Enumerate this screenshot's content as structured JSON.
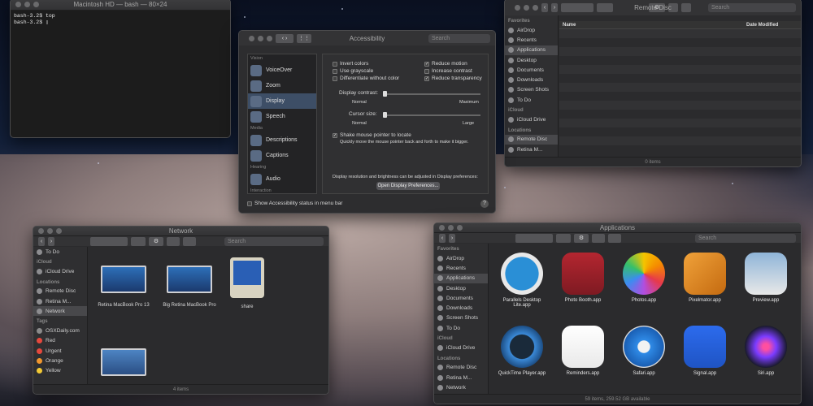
{
  "terminal": {
    "title": "Macintosh HD — bash — 80×24",
    "lines": [
      "bash-3.2$ top",
      "bash-3.2$ ▯"
    ]
  },
  "accessibility": {
    "title": "Accessibility",
    "search_placeholder": "Search",
    "categories": {
      "vision": "Vision",
      "media": "Media",
      "hearing": "Hearing",
      "interaction": "Interaction"
    },
    "items": [
      "VoiceOver",
      "Zoom",
      "Display",
      "Speech",
      "Descriptions",
      "Captions",
      "Audio"
    ],
    "options_left": [
      "Invert colors",
      "Use grayscale",
      "Differentiate without color"
    ],
    "options_right": [
      "Reduce motion",
      "Increase contrast",
      "Reduce transparency"
    ],
    "contrast_label": "Display contrast:",
    "contrast_min": "Normal",
    "contrast_max": "Maximum",
    "cursor_label": "Cursor size:",
    "cursor_min": "Normal",
    "cursor_max": "Large",
    "shake_label": "Shake mouse pointer to locate",
    "shake_desc": "Quickly move the mouse pointer back and forth to make it bigger.",
    "note": "Display resolution and brightness can be adjusted in Display preferences:",
    "open_button": "Open Display Preferences...",
    "status_label": "Show Accessibility status in menu bar",
    "help": "?"
  },
  "remote": {
    "title": "Remote Disc",
    "search_placeholder": "Search",
    "status": "0 items",
    "favorites_title": "Favorites",
    "favorites": [
      "AirDrop",
      "Recents",
      "Applications",
      "Desktop",
      "Documents",
      "Downloads",
      "Screen Shots",
      "To Do"
    ],
    "icloud_title": "iCloud",
    "icloud": [
      "iCloud Drive"
    ],
    "locations_title": "Locations",
    "locations": [
      "Remote Disc",
      "Retina M..."
    ],
    "col_name": "Name",
    "col_date": "Date Modified"
  },
  "network": {
    "title": "Network",
    "search_placeholder": "Search",
    "status": "4 items",
    "sidebar_top": "To Do",
    "icloud_title": "iCloud",
    "icloud": "iCloud Drive",
    "locations_title": "Locations",
    "locations": [
      "Remote Disc",
      "Retina M...",
      "Network"
    ],
    "tags_title": "Tags",
    "tags": [
      {
        "name": "OSXDaily.com",
        "color": "#8a8a8a"
      },
      {
        "name": "Red",
        "color": "#e5483d"
      },
      {
        "name": "Urgent",
        "color": "#e5483d"
      },
      {
        "name": "Orange",
        "color": "#f0962e"
      },
      {
        "name": "Yellow",
        "color": "#f3c935"
      }
    ],
    "items": [
      "Retina MacBook Pro 13",
      "Big Retina MacBook Pro",
      "share",
      ""
    ]
  },
  "apps": {
    "title": "Applications",
    "search_placeholder": "Search",
    "status": "59 items, 259.52 GB available",
    "favorites_title": "Favorites",
    "favorites": [
      "AirDrop",
      "Recents",
      "Applications",
      "Desktop",
      "Documents",
      "Downloads",
      "Screen Shots",
      "To Do"
    ],
    "icloud_title": "iCloud",
    "icloud": "iCloud Drive",
    "locations_title": "Locations",
    "locations": [
      "Remote Disc",
      "Retina M...",
      "Network"
    ],
    "items": [
      {
        "name": "Parallels Desktop Lite.app",
        "icon": "parallels-icon"
      },
      {
        "name": "Photo Booth.app",
        "icon": "photo-booth-icon"
      },
      {
        "name": "Photos.app",
        "icon": "photos-icon"
      },
      {
        "name": "Pixelmator.app",
        "icon": "pixelmator-icon"
      },
      {
        "name": "Preview.app",
        "icon": "preview-icon"
      },
      {
        "name": "QuickTime Player.app",
        "icon": "quicktime-icon"
      },
      {
        "name": "Reminders.app",
        "icon": "reminders-icon"
      },
      {
        "name": "Safari.app",
        "icon": "safari-icon"
      },
      {
        "name": "Signal.app",
        "icon": "signal-icon"
      },
      {
        "name": "Siri.app",
        "icon": "siri-icon"
      }
    ]
  }
}
